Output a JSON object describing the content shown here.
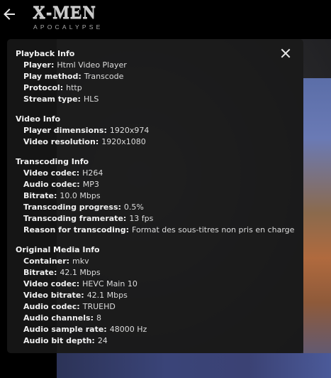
{
  "header": {
    "logo_title": "X-MEN",
    "logo_subtitle": "APOCALYPSE"
  },
  "icons": {
    "back": "arrow-left-icon",
    "close": "close-icon"
  },
  "sections": [
    {
      "title": "Playback Info",
      "rows": [
        {
          "label": "Player:",
          "value": "Html Video Player"
        },
        {
          "label": "Play method:",
          "value": "Transcode"
        },
        {
          "label": "Protocol:",
          "value": "http"
        },
        {
          "label": "Stream type:",
          "value": "HLS"
        }
      ]
    },
    {
      "title": "Video Info",
      "rows": [
        {
          "label": "Player dimensions:",
          "value": "1920x974"
        },
        {
          "label": "Video resolution:",
          "value": "1920x1080"
        }
      ]
    },
    {
      "title": "Transcoding Info",
      "rows": [
        {
          "label": "Video codec:",
          "value": "H264"
        },
        {
          "label": "Audio codec:",
          "value": "MP3"
        },
        {
          "label": "Bitrate:",
          "value": "10.0 Mbps"
        },
        {
          "label": "Transcoding progress:",
          "value": "0.5%"
        },
        {
          "label": "Transcoding framerate:",
          "value": "13 fps"
        },
        {
          "label": "Reason for transcoding:",
          "value": "Format des sous-titres non pris en charge"
        }
      ]
    },
    {
      "title": "Original Media Info",
      "rows": [
        {
          "label": "Container:",
          "value": "mkv"
        },
        {
          "label": "Bitrate:",
          "value": "42.1 Mbps"
        },
        {
          "label": "Video codec:",
          "value": "HEVC Main 10"
        },
        {
          "label": "Video bitrate:",
          "value": "42.1 Mbps"
        },
        {
          "label": "Audio codec:",
          "value": "TRUEHD"
        },
        {
          "label": "Audio channels:",
          "value": "8"
        },
        {
          "label": "Audio sample rate:",
          "value": "48000 Hz"
        },
        {
          "label": "Audio bit depth:",
          "value": "24"
        }
      ]
    }
  ]
}
